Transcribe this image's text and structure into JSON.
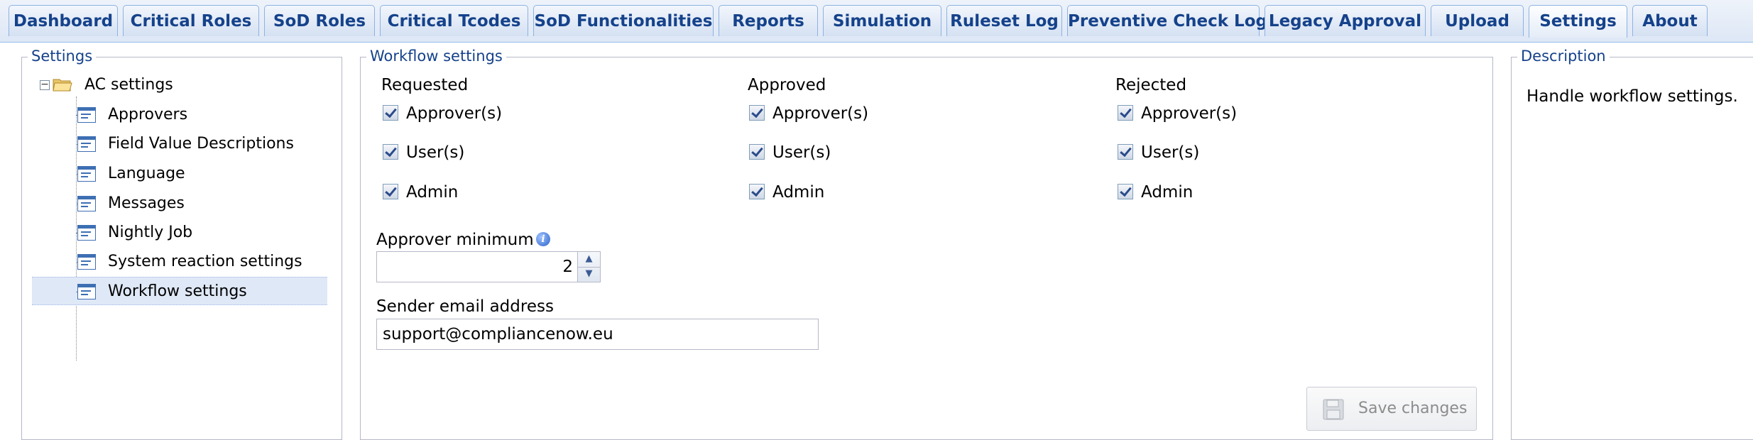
{
  "tabs": [
    {
      "label": "Dashboard"
    },
    {
      "label": "Critical Roles"
    },
    {
      "label": "SoD Roles"
    },
    {
      "label": "Critical Tcodes"
    },
    {
      "label": "SoD Functionalities"
    },
    {
      "label": "Reports"
    },
    {
      "label": "Simulation"
    },
    {
      "label": "Ruleset Log"
    },
    {
      "label": "Preventive Check Log"
    },
    {
      "label": "Legacy Approval"
    },
    {
      "label": "Upload"
    },
    {
      "label": "Settings"
    },
    {
      "label": "About"
    }
  ],
  "active_tab": "Settings",
  "settings_panel": {
    "legend": "Settings",
    "root": {
      "label": "AC settings",
      "icon": "folder-open-icon",
      "expand_icon": "minus-icon"
    },
    "items": [
      {
        "label": "Approvers"
      },
      {
        "label": "Field Value Descriptions"
      },
      {
        "label": "Language"
      },
      {
        "label": "Messages"
      },
      {
        "label": "Nightly Job"
      },
      {
        "label": "System reaction settings"
      },
      {
        "label": "Workflow settings"
      }
    ],
    "selected_item": "Workflow settings"
  },
  "workflow_panel": {
    "legend": "Workflow settings",
    "columns": [
      {
        "heading": "Requested",
        "options": [
          {
            "label": "Approver(s)",
            "checked": true
          },
          {
            "label": "User(s)",
            "checked": true
          },
          {
            "label": "Admin",
            "checked": true
          }
        ]
      },
      {
        "heading": "Approved",
        "options": [
          {
            "label": "Approver(s)",
            "checked": true
          },
          {
            "label": "User(s)",
            "checked": true
          },
          {
            "label": "Admin",
            "checked": true
          }
        ]
      },
      {
        "heading": "Rejected",
        "options": [
          {
            "label": "Approver(s)",
            "checked": true
          },
          {
            "label": "User(s)",
            "checked": true
          },
          {
            "label": "Admin",
            "checked": true
          }
        ]
      }
    ],
    "approver_minimum": {
      "label": "Approver minimum",
      "value": "2",
      "info_icon": "info-icon"
    },
    "sender_email": {
      "label": "Sender email address",
      "value": "support@compliancenow.eu"
    },
    "save_button": {
      "label": "Save changes",
      "icon": "floppy-disk-icon",
      "enabled": false
    }
  },
  "description_panel": {
    "legend": "Description",
    "text": "Handle workflow settings."
  },
  "colors": {
    "tab_text": "#15428b",
    "tab_border": "#8db2e3",
    "legend_text": "#15428b",
    "fieldset_border": "#b5b8c8",
    "selected_row": "#dfe8f6",
    "disabled_text": "#8c8c8c"
  }
}
